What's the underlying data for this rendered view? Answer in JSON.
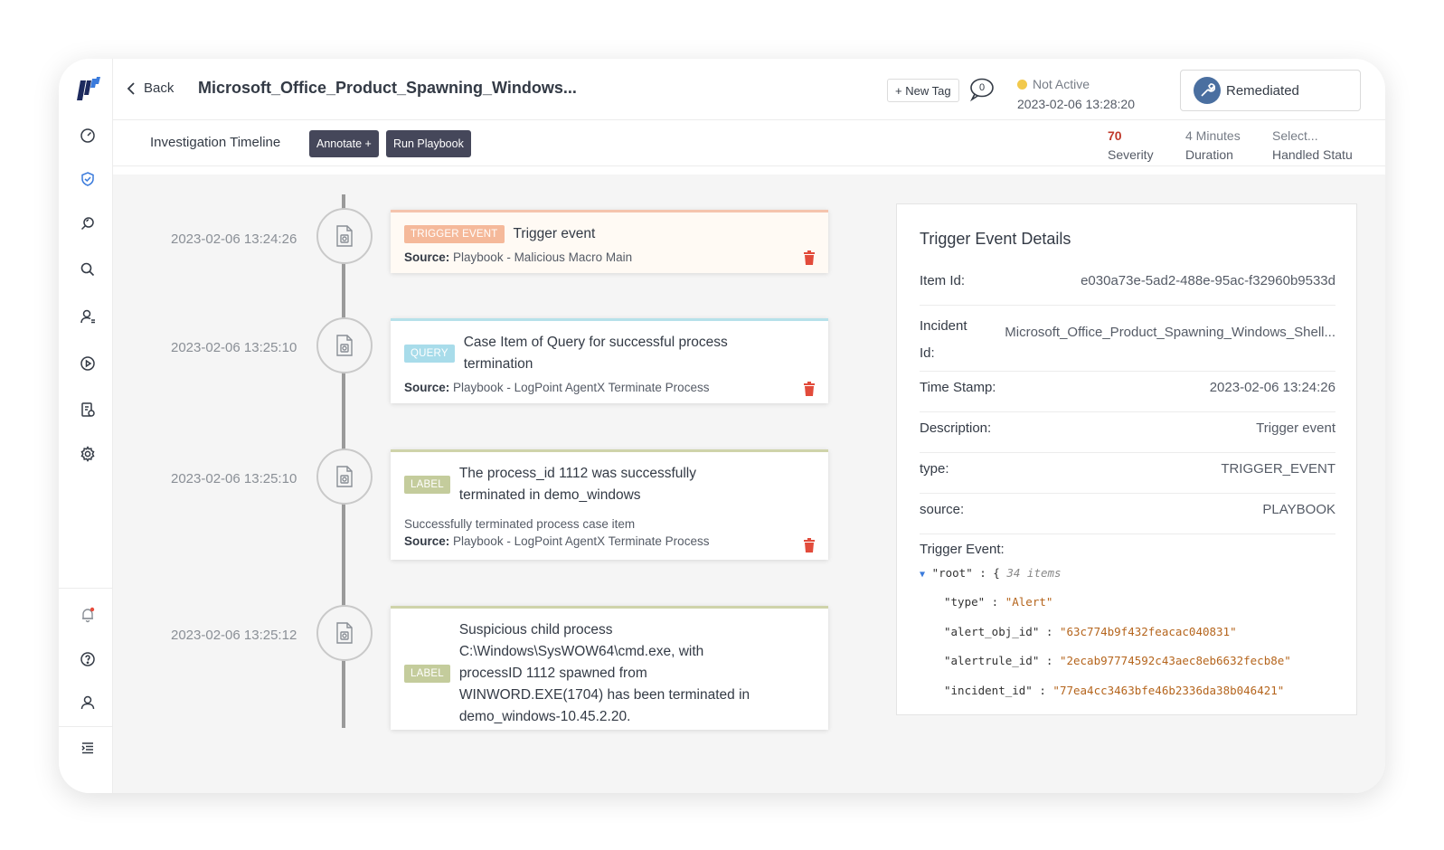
{
  "header": {
    "back_label": "Back",
    "title": "Microsoft_Office_Product_Spawning_Windows...",
    "new_tag_label": "+ New Tag",
    "comment_count": "0",
    "status_label": "Not Active",
    "status_color": "#f2c94c",
    "status_timestamp": "2023-02-06 13:28:20",
    "resolution_label": "Remediated"
  },
  "subheader": {
    "section_title": "Investigation Timeline",
    "annotate_label": "Annotate +",
    "run_playbook_label": "Run Playbook",
    "severity_value": "70",
    "severity_label": "Severity",
    "duration_value": "4 Minutes",
    "duration_label": "Duration",
    "handled_value": "Select...",
    "handled_label": "Handled Statu"
  },
  "timeline": [
    {
      "timestamp": "2023-02-06 13:24:26",
      "tag": "TRIGGER EVENT",
      "tag_color": "#f5b99a",
      "accent_color": "#f5c4ad",
      "title": "Trigger event",
      "source_prefix": "Source:",
      "source": "Playbook - Malicious Macro Main"
    },
    {
      "timestamp": "2023-02-06 13:25:10",
      "tag": "QUERY",
      "tag_color": "#a8dcea",
      "accent_color": "#b6e1ea",
      "title_line1": "Case Item of Query for successful process",
      "title_line2": "termination",
      "source_prefix": "Source:",
      "source": "Playbook - LogPoint AgentX Terminate Process"
    },
    {
      "timestamp": "2023-02-06 13:25:10",
      "tag": "LABEL",
      "tag_color": "#c4cc9c",
      "accent_color": "#cfd3aa",
      "title_line1": "The process_id 1112 was successfully",
      "title_line2": "terminated in demo_windows",
      "description": "Successfully terminated process case item",
      "source_prefix": "Source:",
      "source": "Playbook - LogPoint AgentX Terminate Process"
    },
    {
      "timestamp": "2023-02-06 13:25:12",
      "tag": "LABEL",
      "tag_color": "#c4cc9c",
      "accent_color": "#cfd3aa",
      "title_line1": "Suspicious child process",
      "title_line2": "C:\\Windows\\SysWOW64\\cmd.exe, with",
      "title_line3": "processID 1112 spawned from",
      "title_line4": "WINWORD.EXE(1704) has been terminated in",
      "title_line5": "demo_windows-10.45.2.20."
    }
  ],
  "details": {
    "heading": "Trigger Event Details",
    "item_id_label": "Item Id:",
    "item_id_value": "e030a73e-5ad2-488e-95ac-f32960b9533d",
    "incident_id_label_1": "Incident",
    "incident_id_label_2": "Id:",
    "incident_id_value": "Microsoft_Office_Product_Spawning_Windows_Shell...",
    "time_stamp_label": "Time Stamp:",
    "time_stamp_value": "2023-02-06 13:24:26",
    "description_label": "Description:",
    "description_value": "Trigger event",
    "type_label": "type:",
    "type_value": "TRIGGER_EVENT",
    "source_label": "source:",
    "source_value": "PLAYBOOK",
    "trigger_event_label": "Trigger Event:",
    "json_root_key": "\"root\"",
    "json_root_open": ": {",
    "json_root_count": "34 items",
    "json_rows": [
      {
        "key": "\"type\"",
        "value": "\"Alert\""
      },
      {
        "key": "\"alert_obj_id\"",
        "value": "\"63c774b9f432feacac040831\""
      },
      {
        "key": "\"alertrule_id\"",
        "value": "\"2ecab97774592c43aec8eb6632fecb8e\""
      },
      {
        "key": "\"incident_id\"",
        "value": "\"77ea4cc3463bfe46b2336da38b046421\""
      }
    ]
  },
  "colors": {
    "severity": "#c0392b",
    "delete_icon": "#e24b3b",
    "dark_button": "#45475a",
    "nav_active": "#3b7bdc"
  },
  "icons": {
    "rail": [
      "dashboard-icon",
      "shield-check-icon",
      "search-alt-icon",
      "search-icon",
      "users-icon",
      "play-circle-icon",
      "report-icon",
      "settings-icon",
      "notification-bell-icon",
      "help-icon",
      "user-icon",
      "menu-icon"
    ]
  }
}
